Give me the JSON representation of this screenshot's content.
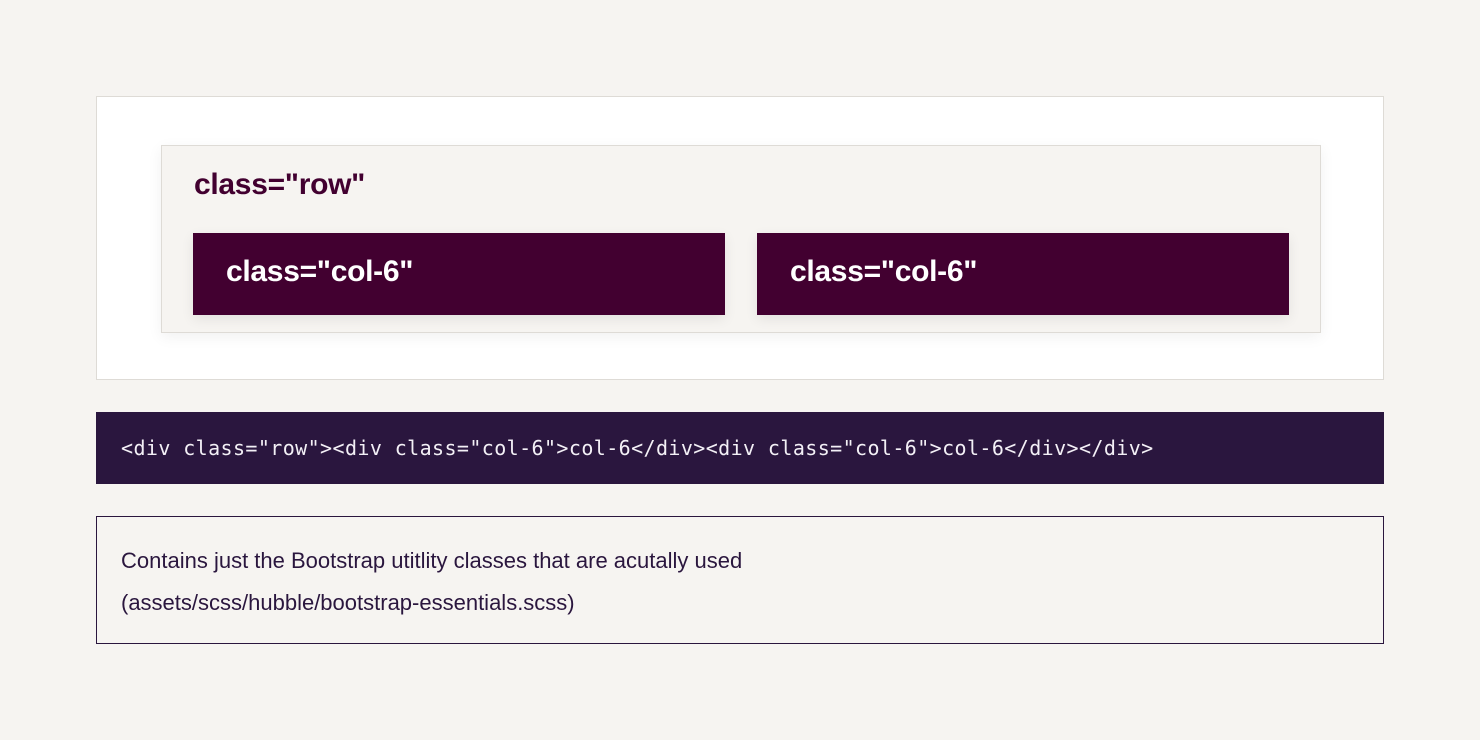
{
  "preview": {
    "row_label": "class=\"row\"",
    "columns": [
      {
        "label": "class=\"col-6\""
      },
      {
        "label": "class=\"col-6\""
      }
    ]
  },
  "code": {
    "snippet": "<div class=\"row\"><div class=\"col-6\">col-6</div><div class=\"col-6\">col-6</div></div>"
  },
  "note": {
    "line1": "Contains just the Bootstrap utitlity classes that are acutally used",
    "line2": "(assets/scss/hubble/bootstrap-essentials.scss)"
  },
  "colors": {
    "background": "#f6f4f1",
    "brand_purple": "#420030",
    "code_background": "#2a163e",
    "card_background": "#ffffff"
  }
}
